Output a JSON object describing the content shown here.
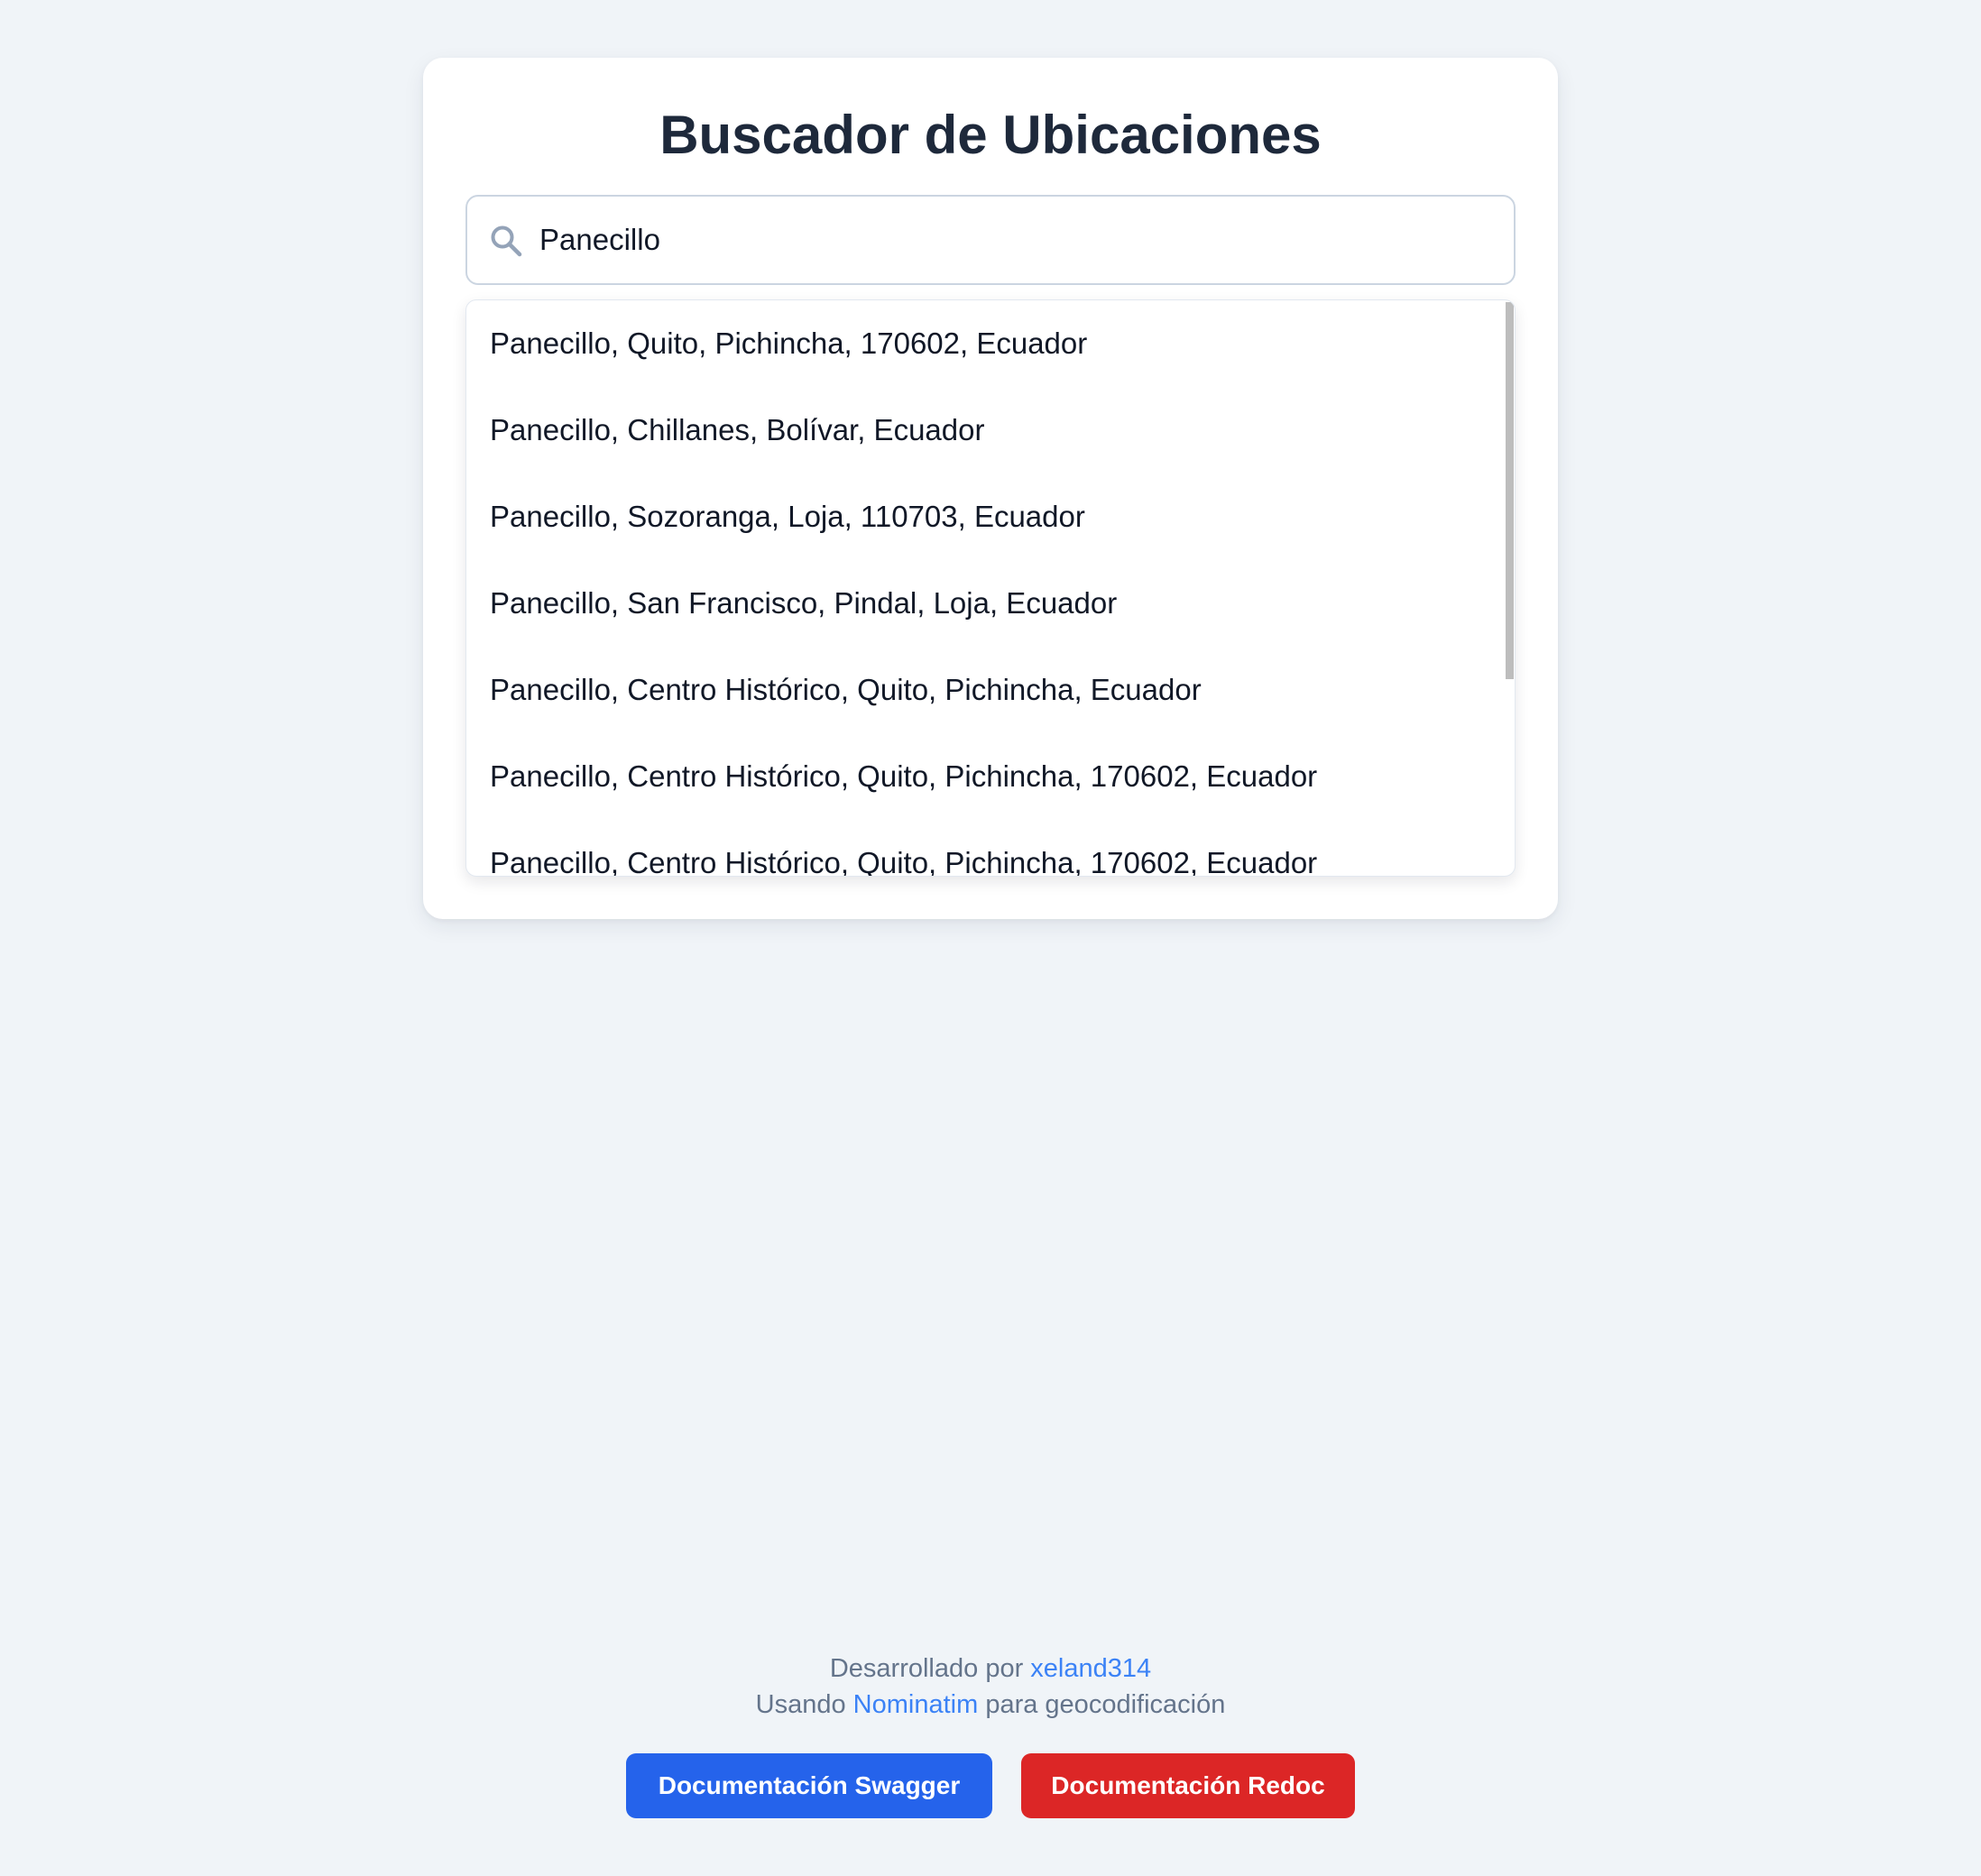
{
  "header": {
    "title": "Buscador de Ubicaciones"
  },
  "search": {
    "value": "Panecillo",
    "icon": "search-icon"
  },
  "results": [
    "Panecillo, Quito, Pichincha, 170602, Ecuador",
    "Panecillo, Chillanes, Bolívar, Ecuador",
    "Panecillo, Sozoranga, Loja, 110703, Ecuador",
    "Panecillo, San Francisco, Pindal, Loja, Ecuador",
    "Panecillo, Centro Histórico, Quito, Pichincha, Ecuador",
    "Panecillo, Centro Histórico, Quito, Pichincha, 170602, Ecuador",
    "Panecillo, Centro Histórico, Quito, Pichincha, 170602, Ecuador"
  ],
  "footer": {
    "developed_by_prefix": "Desarrollado por",
    "developer_link": "xeland314",
    "using_prefix": "Usando",
    "nominatim_link": "Nominatim",
    "using_suffix": "para geocodificación"
  },
  "buttons": {
    "swagger": "Documentación Swagger",
    "redoc": "Documentación Redoc"
  },
  "colors": {
    "background": "#f0f4f8",
    "title": "#1e293b",
    "link": "#3b82f6",
    "swagger_button": "#2563eb",
    "redoc_button": "#dc2626",
    "footer_text": "#64748b"
  }
}
